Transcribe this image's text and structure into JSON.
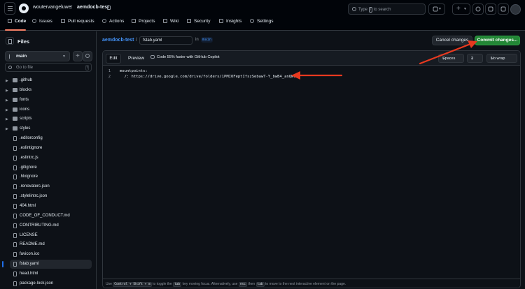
{
  "header": {
    "owner": "woutervangeluwe",
    "repo": "aemdocb-test",
    "search_prefix": "Type",
    "search_key": "/",
    "search_suffix": "to search"
  },
  "nav": [
    {
      "label": "Code",
      "icon": "code-icon",
      "active": true
    },
    {
      "label": "Issues",
      "icon": "issue-icon"
    },
    {
      "label": "Pull requests",
      "icon": "pull-request-icon"
    },
    {
      "label": "Actions",
      "icon": "play-icon"
    },
    {
      "label": "Projects",
      "icon": "table-icon"
    },
    {
      "label": "Wiki",
      "icon": "book-icon"
    },
    {
      "label": "Security",
      "icon": "shield-icon"
    },
    {
      "label": "Insights",
      "icon": "graph-icon"
    },
    {
      "label": "Settings",
      "icon": "gear-icon"
    }
  ],
  "sidebar": {
    "title": "Files",
    "branch": "main",
    "search_placeholder": "Go to file",
    "search_shortcut": "t",
    "items": [
      {
        "label": ".github",
        "type": "folder"
      },
      {
        "label": "blocks",
        "type": "folder"
      },
      {
        "label": "fonts",
        "type": "folder"
      },
      {
        "label": "icons",
        "type": "folder"
      },
      {
        "label": "scripts",
        "type": "folder"
      },
      {
        "label": "styles",
        "type": "folder"
      },
      {
        "label": ".editorconfig",
        "type": "file"
      },
      {
        "label": ".eslintignore",
        "type": "file"
      },
      {
        "label": ".eslintrc.js",
        "type": "file"
      },
      {
        "label": ".gitignore",
        "type": "file"
      },
      {
        "label": ".hlxignore",
        "type": "file"
      },
      {
        "label": ".renovaterc.json",
        "type": "file"
      },
      {
        "label": ".stylelintrc.json",
        "type": "file"
      },
      {
        "label": "404.html",
        "type": "file"
      },
      {
        "label": "CODE_OF_CONDUCT.md",
        "type": "file"
      },
      {
        "label": "CONTRIBUTING.md",
        "type": "file"
      },
      {
        "label": "LICENSE",
        "type": "file"
      },
      {
        "label": "README.md",
        "type": "file"
      },
      {
        "label": "favicon.ico",
        "type": "file"
      },
      {
        "label": "fstab.yaml",
        "type": "file",
        "selected": true
      },
      {
        "label": "head.html",
        "type": "file"
      },
      {
        "label": "package-lock.json",
        "type": "file"
      }
    ]
  },
  "editor": {
    "repo_link": "aemdocb-test",
    "path_sep": "/",
    "filename": "fstab.yaml",
    "in_label": "in",
    "branch": "main",
    "cancel_label": "Cancel changes",
    "commit_label": "Commit changes...",
    "tab_edit": "Edit",
    "tab_preview": "Preview",
    "copilot_text": "Code 55% faster with GitHub Copilot",
    "indent_mode": "Spaces",
    "indent_size": "2",
    "wrap_mode": "No wrap",
    "lines": [
      {
        "n": "1",
        "text": "mountpoints:"
      },
      {
        "n": "2",
        "text": "  /: https://drive.google.com/drive/folders/1PMIOFeptIfszSebawT-Y_bwB4_anQWk5"
      }
    ],
    "footer": {
      "use": "Use",
      "k1": "Control + Shift + m",
      "mid": "to toggle the",
      "k2": "tab",
      "rest": "key moving focus. Alternatively, use",
      "k3": "esc",
      "then": "then",
      "k4": "tab",
      "end": "to move to the next interactive element on the page."
    }
  },
  "colors": {
    "annotation_arrow": "#e8391f",
    "commit_green": "#238636",
    "link_blue": "#4493f8"
  }
}
